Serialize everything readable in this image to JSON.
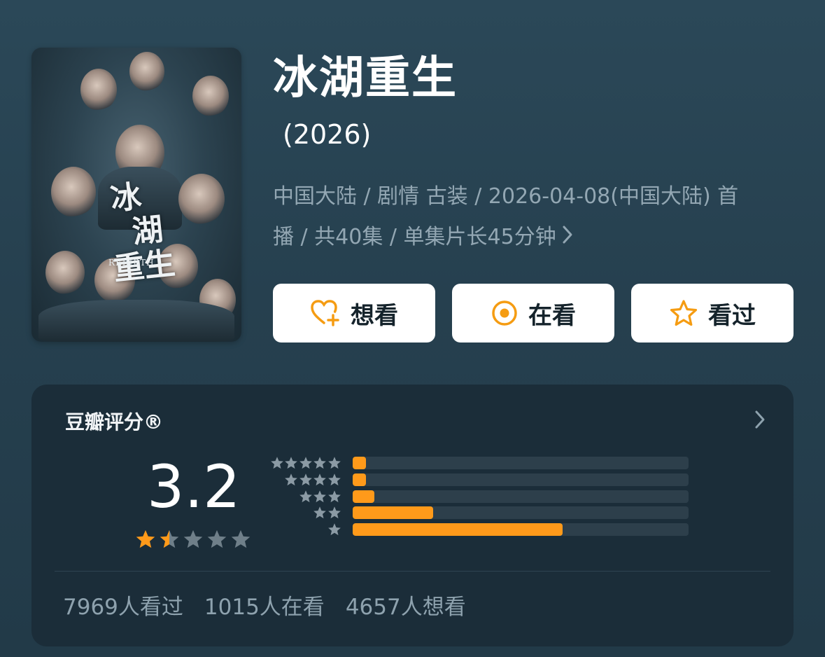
{
  "movie": {
    "title": "冰湖重生",
    "year": "(2026)",
    "meta_line1": "中国大陆 / 剧情 古装 / 2026-04-08(中国大陆) 首",
    "meta_line2": "播 / 共40集 / 单集片长45分钟",
    "poster": {
      "title_art_1": "冰",
      "title_art_2": "湖",
      "title_art_3": "重生",
      "title_art_en": "REBIRTH"
    }
  },
  "actions": [
    {
      "label": "想看",
      "icon": "heart-plus-icon",
      "color": "#f59c12"
    },
    {
      "label": "在看",
      "icon": "target-icon",
      "color": "#f59c12"
    },
    {
      "label": "看过",
      "icon": "star-outline-icon",
      "color": "#f59c12"
    }
  ],
  "rating": {
    "label": "豆瓣评分®",
    "score": "3.2",
    "stars_filled": 1.5,
    "stars_total": 5,
    "distribution": [
      {
        "stars": 5,
        "fraction": 0.04
      },
      {
        "stars": 4,
        "fraction": 0.04
      },
      {
        "stars": 3,
        "fraction": 0.065
      },
      {
        "stars": 2,
        "fraction": 0.24
      },
      {
        "stars": 1,
        "fraction": 0.625
      }
    ],
    "accent_color": "#ff9a1a"
  },
  "stats": {
    "watched": "7969人看过",
    "watching": "1015人在看",
    "want": "4657人想看"
  }
}
